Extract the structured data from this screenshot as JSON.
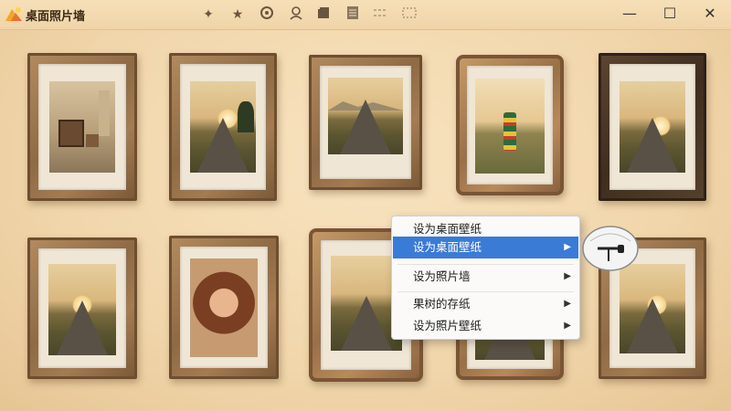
{
  "window": {
    "title": "桌面照片墙",
    "toolbar_icons": [
      "pin-icon",
      "star-icon",
      "shield-icon",
      "user-icon",
      "gallery-icon",
      "document-icon",
      "grid-icon",
      "fullscreen-icon"
    ],
    "controls": {
      "minimize": "—",
      "maximize": "☐",
      "close": "✕"
    }
  },
  "context_menu": {
    "items": [
      {
        "label": "设为桌面壁纸",
        "submenu": false,
        "selected": false
      },
      {
        "label": "设为桌面壁纸",
        "submenu": true,
        "selected": true
      },
      {
        "label": "设为照片墙",
        "submenu": true,
        "selected": false
      },
      {
        "label": "果树的存纸",
        "submenu": true,
        "selected": false
      },
      {
        "label": "设为照片壁纸",
        "submenu": true,
        "selected": false
      }
    ],
    "arrow": "▶"
  },
  "colors": {
    "accent": "#3a7bd5",
    "title_bg": "#f0d4a8",
    "wall": "#f3dcb6"
  }
}
